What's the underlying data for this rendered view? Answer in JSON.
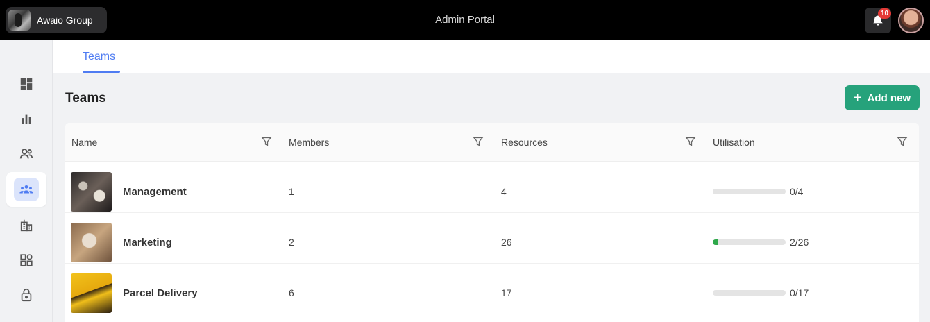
{
  "header": {
    "org_name": "Awaio Group",
    "app_title": "Admin Portal",
    "notification_count": "10"
  },
  "sidebar": {
    "items": [
      {
        "icon": "dashboard-icon",
        "active": false
      },
      {
        "icon": "bar-chart-icon",
        "active": false
      },
      {
        "icon": "users-icon",
        "active": false
      },
      {
        "icon": "teams-icon",
        "active": true
      },
      {
        "icon": "buildings-icon",
        "active": false
      },
      {
        "icon": "apps-icon",
        "active": false
      },
      {
        "icon": "lock-icon",
        "active": false
      }
    ]
  },
  "tabs": [
    {
      "label": "Teams",
      "active": true
    }
  ],
  "page": {
    "title": "Teams",
    "add_button_label": "Add new"
  },
  "table": {
    "columns": [
      "Name",
      "Members",
      "Resources",
      "Utilisation"
    ],
    "rows": [
      {
        "name": "Management",
        "members": "1",
        "resources": "4",
        "utilisation": "0/4",
        "utilisation_fraction": 0
      },
      {
        "name": "Marketing",
        "members": "2",
        "resources": "26",
        "utilisation": "2/26",
        "utilisation_fraction": 0.0769
      },
      {
        "name": "Parcel Delivery",
        "members": "6",
        "resources": "17",
        "utilisation": "0/17",
        "utilisation_fraction": 0
      }
    ]
  },
  "colors": {
    "accent": "#4f7cf2",
    "primary_button": "#26a27b",
    "progress_fill": "#2ea84a",
    "badge": "#e53935"
  }
}
